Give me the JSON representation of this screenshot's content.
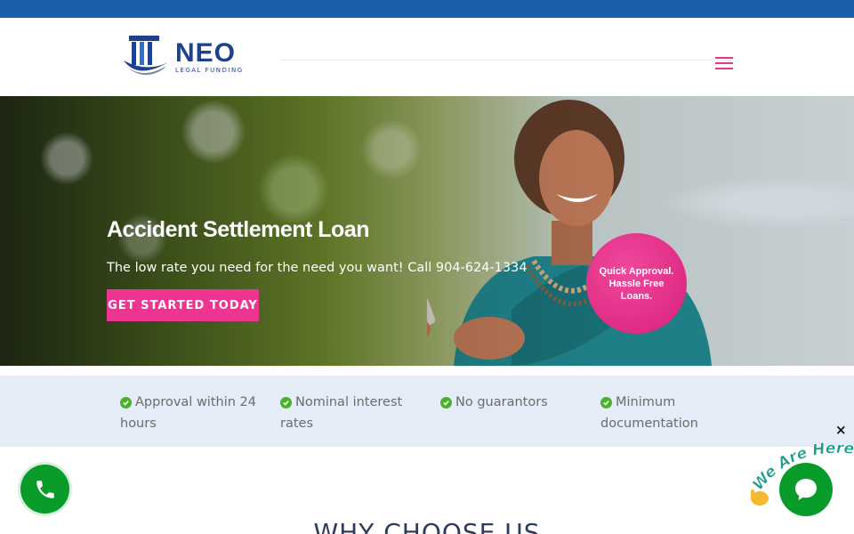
{
  "colors": {
    "topbar": "#1a5fa8",
    "accent_pink": "#ee3592",
    "brand_navy": "#1f3f8f",
    "check_green": "#4caf2e",
    "call_green": "#0a9c2a",
    "features_bg": "#e4ecf7"
  },
  "logo": {
    "name": "NEO",
    "tagline": "LEGAL FUNDING"
  },
  "nav": {
    "menu_icon": "hamburger-icon"
  },
  "hero": {
    "title": "Accident Settlement Loan",
    "subtitle": "The low rate you need for the need you want! Call 904-624-1334",
    "cta_label": "GET STARTED TODAY",
    "badge": "Quick Approval. Hassle Free Loans."
  },
  "features": [
    {
      "icon": "check-circle-icon",
      "label": "Approval within 24 hours"
    },
    {
      "icon": "check-circle-icon",
      "label": "Nominal interest rates"
    },
    {
      "icon": "check-circle-icon",
      "label": "No guarantors"
    },
    {
      "icon": "check-circle-icon",
      "label": "Minimum documentation"
    }
  ],
  "section": {
    "heading": "WHY CHOOSE US"
  },
  "widgets": {
    "call_icon": "phone-icon",
    "chat_label": "We Are Here!",
    "close": "×",
    "chat_icon": "chat-bubble-icon"
  }
}
